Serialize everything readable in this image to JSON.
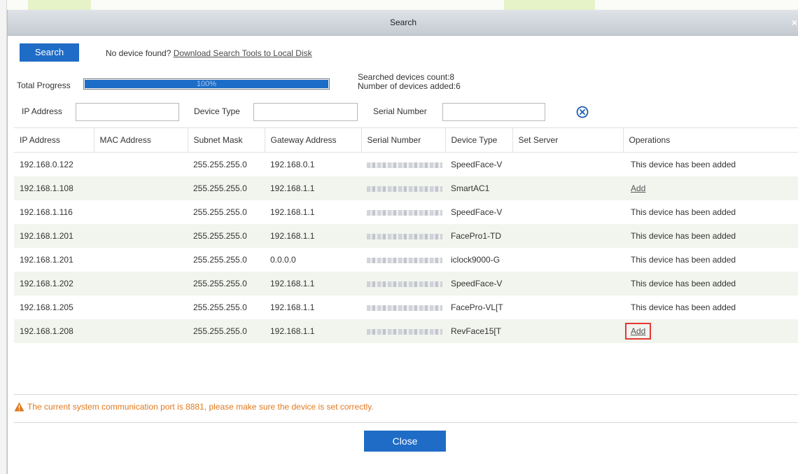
{
  "dialog": {
    "title": "Search"
  },
  "search_button": "Search",
  "help": {
    "text": "No device found? ",
    "link": "Download Search Tools to Local Disk"
  },
  "progress": {
    "label": "Total Progress",
    "percent_text": "100%",
    "value": 1.0
  },
  "stats": {
    "searched": "Searched devices count:8",
    "added": "Number of devices added:6"
  },
  "filters": {
    "ip_label": "IP Address",
    "ip_value": "",
    "type_label": "Device Type",
    "type_value": "",
    "serial_label": "Serial Number",
    "serial_value": ""
  },
  "table": {
    "columns": [
      "IP Address",
      "MAC Address",
      "Subnet Mask",
      "Gateway Address",
      "Serial Number",
      "Device Type",
      "Set Server",
      "Operations"
    ],
    "rows": [
      {
        "ip": "192.168.0.122",
        "mac": "",
        "mask": "255.255.255.0",
        "gateway": "192.168.0.1",
        "type": "SpeedFace-V",
        "server": "",
        "op": "This device has been added"
      },
      {
        "ip": "192.168.1.108",
        "mac": "",
        "mask": "255.255.255.0",
        "gateway": "192.168.1.1",
        "type": "SmartAC1",
        "server": "",
        "op": "Add"
      },
      {
        "ip": "192.168.1.116",
        "mac": "",
        "mask": "255.255.255.0",
        "gateway": "192.168.1.1",
        "type": "SpeedFace-V",
        "server": "",
        "op": "This device has been added"
      },
      {
        "ip": "192.168.1.201",
        "mac": "",
        "mask": "255.255.255.0",
        "gateway": "192.168.1.1",
        "type": "FacePro1-TD",
        "server": "",
        "op": "This device has been added"
      },
      {
        "ip": "192.168.1.201",
        "mac": "",
        "mask": "255.255.255.0",
        "gateway": "0.0.0.0",
        "type": "iclock9000-G",
        "server": "",
        "op": "This device has been added"
      },
      {
        "ip": "192.168.1.202",
        "mac": "",
        "mask": "255.255.255.0",
        "gateway": "192.168.1.1",
        "type": "SpeedFace-V",
        "server": "",
        "op": "This device has been added"
      },
      {
        "ip": "192.168.1.205",
        "mac": "",
        "mask": "255.255.255.0",
        "gateway": "192.168.1.1",
        "type": "FacePro-VL[T",
        "server": "",
        "op": "This device has been added"
      },
      {
        "ip": "192.168.1.208",
        "mac": "",
        "mask": "255.255.255.0",
        "gateway": "192.168.1.1",
        "type": "RevFace15[T",
        "server": "",
        "op": "Add"
      }
    ]
  },
  "warning": "The current system communication port is 8881, please make sure the device is set correctly.",
  "close_button": "Close",
  "icons": {
    "clear": "clear-circle-x-icon",
    "warning": "warning-triangle-icon",
    "close": "close-icon"
  },
  "colors": {
    "primary": "#1f6cc6",
    "warning": "#e07a1f",
    "highlight": "#e53935"
  }
}
